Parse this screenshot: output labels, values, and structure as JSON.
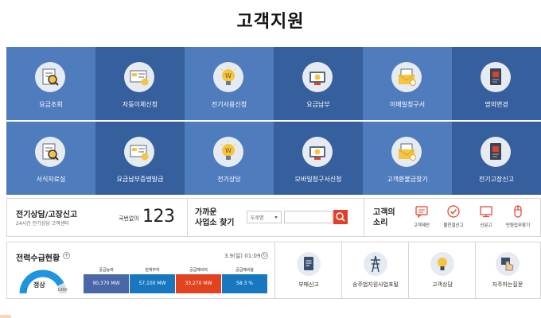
{
  "page": {
    "title": "고객지원"
  },
  "tiles_row1": [
    {
      "label": "요금조회",
      "icon": "magnifier-document-icon",
      "shade": "light"
    },
    {
      "label": "자동이체신청",
      "icon": "card-check-icon",
      "shade": "dark"
    },
    {
      "label": "전기사용신청",
      "icon": "lightbulb-won-icon",
      "shade": "light"
    },
    {
      "label": "요금납부",
      "icon": "payment-card-icon",
      "shade": "dark"
    },
    {
      "label": "이메일청구서",
      "icon": "email-invoice-icon",
      "shade": "light"
    },
    {
      "label": "명의변경",
      "icon": "id-card-icon",
      "shade": "dark"
    }
  ],
  "tiles_row2": [
    {
      "label": "서식자료실",
      "icon": "magnifier-document-icon",
      "shade": "light"
    },
    {
      "label": "요금납부증명발급",
      "icon": "card-check-icon",
      "shade": "dark"
    },
    {
      "label": "전기상담",
      "icon": "lightbulb-won-icon",
      "shade": "light"
    },
    {
      "label": "모바일청구서신청",
      "icon": "payment-card-icon",
      "shade": "dark"
    },
    {
      "label": "고객환불금찾기",
      "icon": "email-invoice-icon",
      "shade": "light"
    },
    {
      "label": "전기고장신고",
      "icon": "id-card-icon",
      "shade": "dark"
    }
  ],
  "consult": {
    "title": "전기상담/고장신고",
    "subtitle": "24시간 전기상담 고객센터",
    "number_label": "국번없이",
    "number": "123"
  },
  "nearby": {
    "title_line1": "가까운",
    "title_line2": "사업소 찾기",
    "select_value": "도로명",
    "search_icon": "search-icon"
  },
  "voice": {
    "title_line1": "고객의",
    "title_line2": "소리",
    "items": [
      {
        "label": "고객제안",
        "icon": "speech-bubble-icon"
      },
      {
        "label": "불친절신고",
        "icon": "check-circle-icon"
      },
      {
        "label": "신문고",
        "icon": "monitor-icon"
      },
      {
        "label": "민원업무찾기",
        "icon": "mouse-icon"
      }
    ]
  },
  "power": {
    "title": "전력수급현황",
    "date": "3.9(일) 01:09",
    "gauge_status": "정상",
    "gauge_min": "0",
    "gauge_max": "1000",
    "gauge_level": 0.85,
    "stats": [
      {
        "label": "공급능력",
        "value": "90,370 MW",
        "color": "#4a67a8"
      },
      {
        "label": "현재부하",
        "value": "57,100 MW",
        "color": "#1878bf"
      },
      {
        "label": "공급예비력",
        "value": "33,270 MW",
        "color": "#e2431e"
      },
      {
        "label": "공급예비율",
        "value": "58.3 %",
        "color": "#1878bf"
      }
    ]
  },
  "quicklinks": [
    {
      "label": "부패신고",
      "icon": "document-icon"
    },
    {
      "label": "송주법지원사업포털",
      "icon": "power-tower-icon"
    },
    {
      "label": "고객상담",
      "icon": "lightbulb-icon"
    },
    {
      "label": "자주하는질문",
      "icon": "hand-pointer-icon"
    }
  ],
  "colors": {
    "tile_light": "#4f7cbd",
    "tile_dark": "#365f9e",
    "accent_red": "#e0402a",
    "gauge_blue": "#1f95e0"
  }
}
